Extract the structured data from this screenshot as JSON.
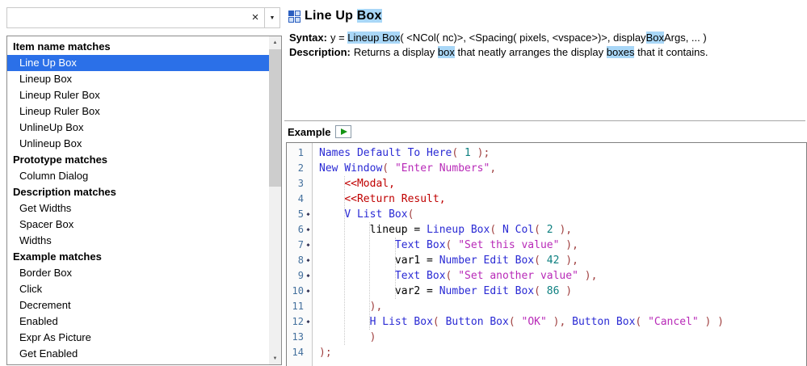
{
  "colors": {
    "selection": "#2B70E8",
    "match_highlight": "#A9D7F7",
    "code_fn": "#2A2AD4",
    "code_str": "#B82AB8",
    "code_num": "#0E8080",
    "code_msg": "#C00000",
    "code_punct": "#A04040",
    "gutter_number": "#44709D",
    "panel_border": "#8C8C8C",
    "divider": "#A6A6A6"
  },
  "search": {
    "value": "",
    "clear_icon": "×",
    "dropdown_icon": "▼",
    "scroll_up_icon": "▲",
    "scroll_down_icon": "▼"
  },
  "left_list": {
    "selected": "Line Up Box",
    "groups": [
      {
        "header": "Item name matches",
        "items": [
          "Line Up Box",
          "Lineup Box",
          "Lineup Ruler Box",
          "Lineup Ruler Box",
          "UnlineUp Box",
          "Unlineup Box"
        ]
      },
      {
        "header": "Prototype matches",
        "items": [
          "Column Dialog"
        ]
      },
      {
        "header": "Description matches",
        "items": [
          "Get Widths",
          "Spacer Box",
          "Widths"
        ]
      },
      {
        "header": "Example matches",
        "items": [
          "Border Box",
          "Click",
          "Decrement",
          "Enabled",
          "Expr As Picture",
          "Get Enabled"
        ]
      }
    ]
  },
  "detail": {
    "title_parts": [
      {
        "t": "Line Up ",
        "hl": false
      },
      {
        "t": "Box",
        "hl": true
      }
    ],
    "syntax_label": "Syntax:",
    "syntax_parts": [
      {
        "t": "y = ",
        "hl": false
      },
      {
        "t": "Lineup Box",
        "hl": true
      },
      {
        "t": "( <NCol( nc)>, <Spacing( pixels, <vspace>)>, display",
        "hl": false
      },
      {
        "t": "Box",
        "hl": true
      },
      {
        "t": "Args, ... )",
        "hl": false
      }
    ],
    "description_label": "Description:",
    "description_parts": [
      {
        "t": "Returns a display ",
        "hl": false
      },
      {
        "t": "box",
        "hl": true
      },
      {
        "t": " that neatly arranges the display ",
        "hl": false
      },
      {
        "t": "boxes",
        "hl": true
      },
      {
        "t": " that it contains.",
        "hl": false
      }
    ],
    "example_label": "Example"
  },
  "code": {
    "marker_icon": "◆",
    "lines": [
      {
        "n": 1,
        "marker": false,
        "tokens": [
          {
            "c": "fn",
            "t": "Names Default To Here"
          },
          {
            "c": "pn",
            "t": "( "
          },
          {
            "c": "num",
            "t": "1"
          },
          {
            "c": "pn",
            "t": " );"
          }
        ]
      },
      {
        "n": 2,
        "marker": false,
        "tokens": [
          {
            "c": "fn",
            "t": "New Window"
          },
          {
            "c": "pn",
            "t": "( "
          },
          {
            "c": "str",
            "t": "\"Enter Numbers\""
          },
          {
            "c": "pn",
            "t": ","
          }
        ]
      },
      {
        "n": 3,
        "marker": false,
        "tokens": [
          {
            "c": "id",
            "t": "    "
          },
          {
            "c": "msg",
            "t": "<<Modal,"
          }
        ]
      },
      {
        "n": 4,
        "marker": false,
        "tokens": [
          {
            "c": "id",
            "t": "    "
          },
          {
            "c": "msg",
            "t": "<<Return Result,"
          }
        ]
      },
      {
        "n": 5,
        "marker": true,
        "tokens": [
          {
            "c": "id",
            "t": "    "
          },
          {
            "c": "fn",
            "t": "V List Box"
          },
          {
            "c": "pn",
            "t": "("
          }
        ]
      },
      {
        "n": 6,
        "marker": true,
        "tokens": [
          {
            "c": "id",
            "t": "        lineup = "
          },
          {
            "c": "fn",
            "t": "Lineup Box"
          },
          {
            "c": "pn",
            "t": "( "
          },
          {
            "c": "fn",
            "t": "N Col"
          },
          {
            "c": "pn",
            "t": "( "
          },
          {
            "c": "num",
            "t": "2"
          },
          {
            "c": "pn",
            "t": " ),"
          }
        ]
      },
      {
        "n": 7,
        "marker": true,
        "tokens": [
          {
            "c": "id",
            "t": "            "
          },
          {
            "c": "fn",
            "t": "Text Box"
          },
          {
            "c": "pn",
            "t": "( "
          },
          {
            "c": "str",
            "t": "\"Set this value\""
          },
          {
            "c": "pn",
            "t": " ),"
          }
        ]
      },
      {
        "n": 8,
        "marker": true,
        "tokens": [
          {
            "c": "id",
            "t": "            var1 = "
          },
          {
            "c": "fn",
            "t": "Number Edit Box"
          },
          {
            "c": "pn",
            "t": "( "
          },
          {
            "c": "num",
            "t": "42"
          },
          {
            "c": "pn",
            "t": " ),"
          }
        ]
      },
      {
        "n": 9,
        "marker": true,
        "tokens": [
          {
            "c": "id",
            "t": "            "
          },
          {
            "c": "fn",
            "t": "Text Box"
          },
          {
            "c": "pn",
            "t": "( "
          },
          {
            "c": "str",
            "t": "\"Set another value\""
          },
          {
            "c": "pn",
            "t": " ),"
          }
        ]
      },
      {
        "n": 10,
        "marker": true,
        "tokens": [
          {
            "c": "id",
            "t": "            var2 = "
          },
          {
            "c": "fn",
            "t": "Number Edit Box"
          },
          {
            "c": "pn",
            "t": "( "
          },
          {
            "c": "num",
            "t": "86"
          },
          {
            "c": "pn",
            "t": " )"
          }
        ]
      },
      {
        "n": 11,
        "marker": false,
        "tokens": [
          {
            "c": "id",
            "t": "        "
          },
          {
            "c": "pn",
            "t": "),"
          }
        ]
      },
      {
        "n": 12,
        "marker": true,
        "tokens": [
          {
            "c": "id",
            "t": "        "
          },
          {
            "c": "fn",
            "t": "H List Box"
          },
          {
            "c": "pn",
            "t": "( "
          },
          {
            "c": "fn",
            "t": "Button Box"
          },
          {
            "c": "pn",
            "t": "( "
          },
          {
            "c": "str",
            "t": "\"OK\""
          },
          {
            "c": "pn",
            "t": " ), "
          },
          {
            "c": "fn",
            "t": "Button Box"
          },
          {
            "c": "pn",
            "t": "( "
          },
          {
            "c": "str",
            "t": "\"Cancel\""
          },
          {
            "c": "pn",
            "t": " ) )"
          }
        ]
      },
      {
        "n": 13,
        "marker": false,
        "tokens": [
          {
            "c": "id",
            "t": "        "
          },
          {
            "c": "pn",
            "t": ")"
          }
        ]
      },
      {
        "n": 14,
        "marker": false,
        "tokens": [
          {
            "c": "pn",
            "t": ");"
          }
        ]
      }
    ]
  }
}
